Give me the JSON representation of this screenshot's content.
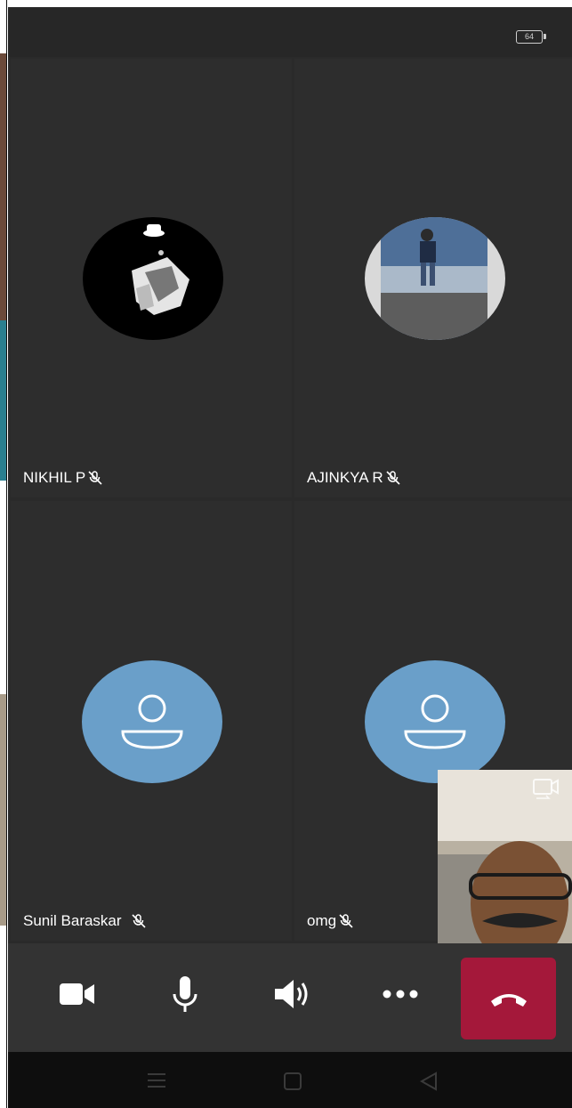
{
  "status_bar": {
    "battery": "64"
  },
  "participants": [
    {
      "name": "NIKHIL P",
      "muted": true,
      "avatar": "photo"
    },
    {
      "name": "AJINKYA R",
      "muted": true,
      "avatar": "photo"
    },
    {
      "name": "Sunil Baraskar",
      "muted": true,
      "avatar": "default-person"
    },
    {
      "name": "omg",
      "muted": true,
      "avatar": "default-person"
    }
  ],
  "controls": {
    "video_icon": "video-camera-icon",
    "mic_icon": "microphone-icon",
    "speaker_icon": "speaker-icon",
    "more_icon": "more-dots-icon",
    "end_icon": "end-call-icon"
  },
  "colors": {
    "background": "#2a2a2a",
    "tile": "#2d2d2d",
    "control_bar": "#333333",
    "end_call": "#a4183a",
    "avatar_default": "#6a9fc9",
    "nav_bar": "#0e0e0e"
  }
}
